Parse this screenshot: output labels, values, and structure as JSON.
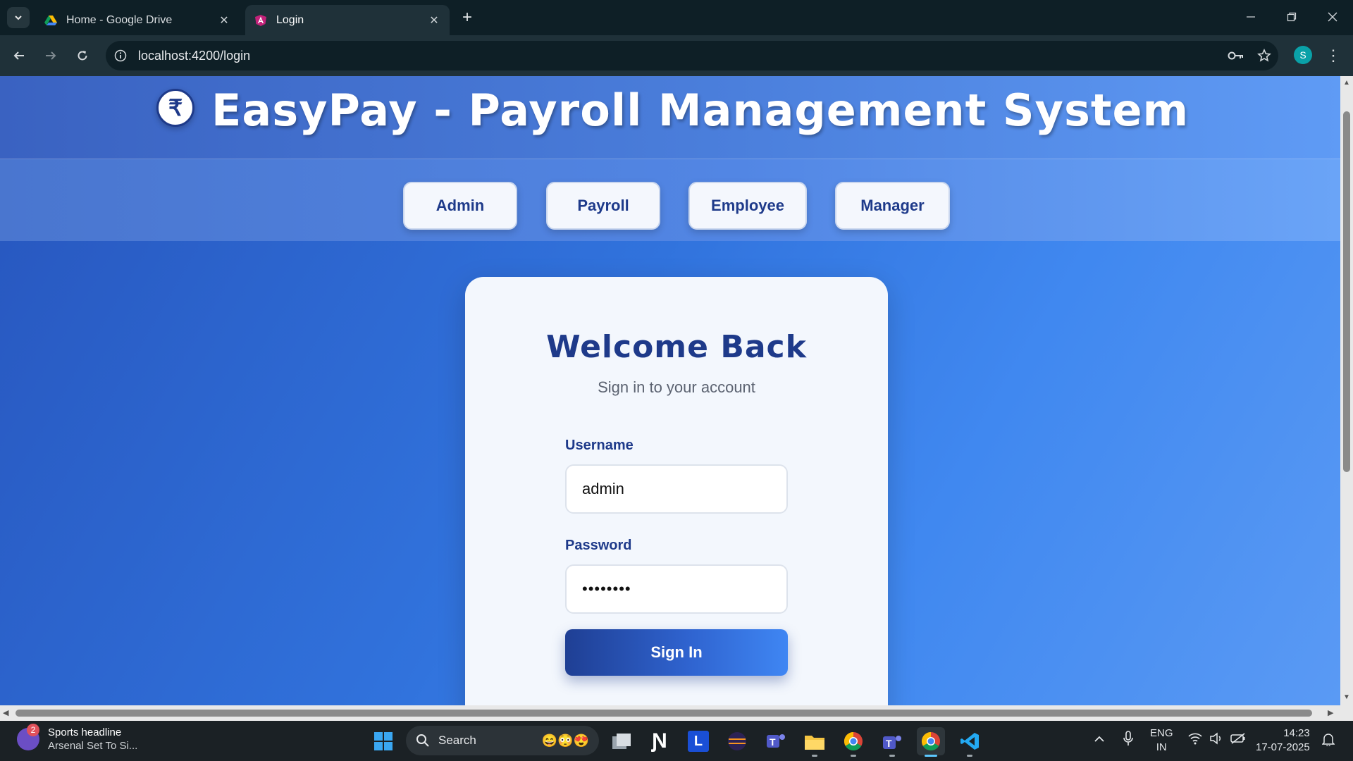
{
  "browser": {
    "tabs": [
      {
        "title": "Home - Google Drive",
        "active": false
      },
      {
        "title": "Login",
        "active": true
      }
    ],
    "url": "localhost:4200/login",
    "profile_initial": "S"
  },
  "app": {
    "logo_symbol": "₹",
    "title": "EasyPay - Payroll Management System",
    "nav": [
      "Admin",
      "Payroll",
      "Employee",
      "Manager"
    ]
  },
  "login": {
    "heading": "Welcome Back",
    "subheading": "Sign in to your account",
    "username_label": "Username",
    "username_value": "admin",
    "password_label": "Password",
    "password_value": "••••••••",
    "submit_label": "Sign In"
  },
  "taskbar": {
    "news_badge": "2",
    "news_title": "Sports headline",
    "news_subtitle": "Arsenal Set To Si...",
    "search_label": "Search",
    "language_line1": "ENG",
    "language_line2": "IN",
    "time": "14:23",
    "date": "17-07-2025",
    "letter_app": "L"
  },
  "colors": {
    "accent": "#1e3a8a",
    "page_gradient_start": "#2755bd",
    "page_gradient_end": "#5a9af4",
    "card_bg": "#f3f7fd"
  }
}
